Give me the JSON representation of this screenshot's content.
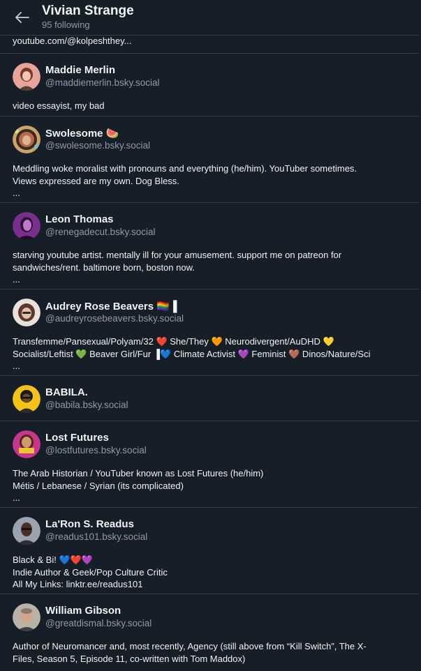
{
  "header": {
    "back_icon": "arrow-left-icon",
    "title": "Vivian Strange",
    "subtitle": "95 following"
  },
  "colors": {
    "background": "#161e27",
    "border": "#2e4052",
    "text": "#f1f3f5",
    "muted": "#8d9bab"
  },
  "cut_item": {
    "description": "youtube.com/@kolpeshthey..."
  },
  "profiles": [
    {
      "name": "Maddie Merlin",
      "handle": "@maddiemerlin.bsky.social",
      "description": [
        "video essayist, my bad"
      ]
    },
    {
      "name": "Swolesome 🍉",
      "handle": "@swolesome.bsky.social",
      "description": [
        "Meddling woke moralist with pronouns and everything (he/him). YouTuber sometimes.",
        "Views expressed are my own. Dog Bless.",
        "..."
      ]
    },
    {
      "name": "Leon Thomas",
      "handle": "@renegadecut.bsky.social",
      "description": [
        "starving youtube artist. mentally ill for your amusement. support me on patreon for",
        "sandwiches/rent. baltimore born, boston now.",
        "..."
      ]
    },
    {
      "name": "Audrey Rose Beavers 🏳️‍🌈▐",
      "handle": "@audreyrosebeavers.bsky.social",
      "description": [
        "Transfemme/Pansexual/Polyam/32 ❤️ She/They 🧡 Neurodivergent/AuDHD 💛",
        "Socialist/Leftist 💚 Beaver Girl/Fur ▐💙 Climate Activist 💜 Feminist 🤎 Dinos/Nature/Sci",
        "..."
      ]
    },
    {
      "name": "BABILA.",
      "handle": "@babila.bsky.social",
      "description": []
    },
    {
      "name": "Lost Futures",
      "handle": "@lostfutures.bsky.social",
      "description": [
        "The Arab Historian / YouTuber known as Lost Futures (he/him)",
        "Métis / Lebanese / Syrian (its complicated)",
        "..."
      ]
    },
    {
      "name": "La'Ron S. Readus",
      "handle": "@readus101.bsky.social",
      "description": [
        "Black & Bi! 💙❤️💜",
        "Indie Author & Geek/Pop Culture Critic",
        "All My Links: linktr.ee/readus101"
      ]
    },
    {
      "name": "William Gibson",
      "handle": "@greatdismal.bsky.social",
      "description": [
        "Author of Neuromancer and, most recently, Agency (still above from “Kill Switch”, The X-",
        "Files, Season 5, Episode 11, co-written with Tom Maddox)"
      ]
    }
  ]
}
